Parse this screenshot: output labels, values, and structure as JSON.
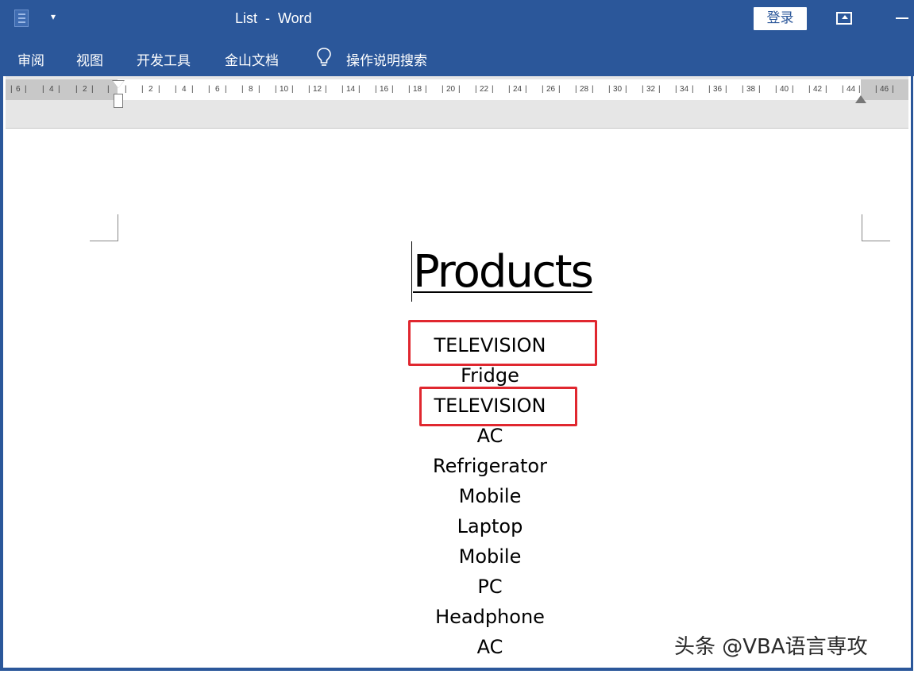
{
  "window": {
    "title": "List  -  Word",
    "qat_arrow": "▾",
    "login_label": "登录"
  },
  "ribbon_tabs": [
    "审阅",
    "视图",
    "开发工具",
    "金山文档"
  ],
  "tell_me": "操作说明搜索",
  "ruler_labels": [
    "6",
    "4",
    "2",
    "2",
    "4",
    "6",
    "8",
    "10",
    "12",
    "14",
    "16",
    "18",
    "20",
    "22",
    "24",
    "26",
    "28",
    "30",
    "32",
    "34",
    "36",
    "38",
    "40",
    "42",
    "44",
    "46"
  ],
  "document": {
    "heading": "Products",
    "items": [
      "TELEVISION",
      "Fridge",
      "TELEVISION",
      "AC",
      "Refrigerator",
      "Mobile",
      "Laptop",
      "Mobile",
      "PC",
      "Headphone",
      "AC"
    ],
    "highlighted_indices": [
      0,
      2
    ],
    "highlight_color": "#e0272f"
  },
  "watermark": "头条 @VBA语言専攻",
  "colors": {
    "ribbon": "#2b579a",
    "ruler_bg": "#e6e6e6"
  }
}
